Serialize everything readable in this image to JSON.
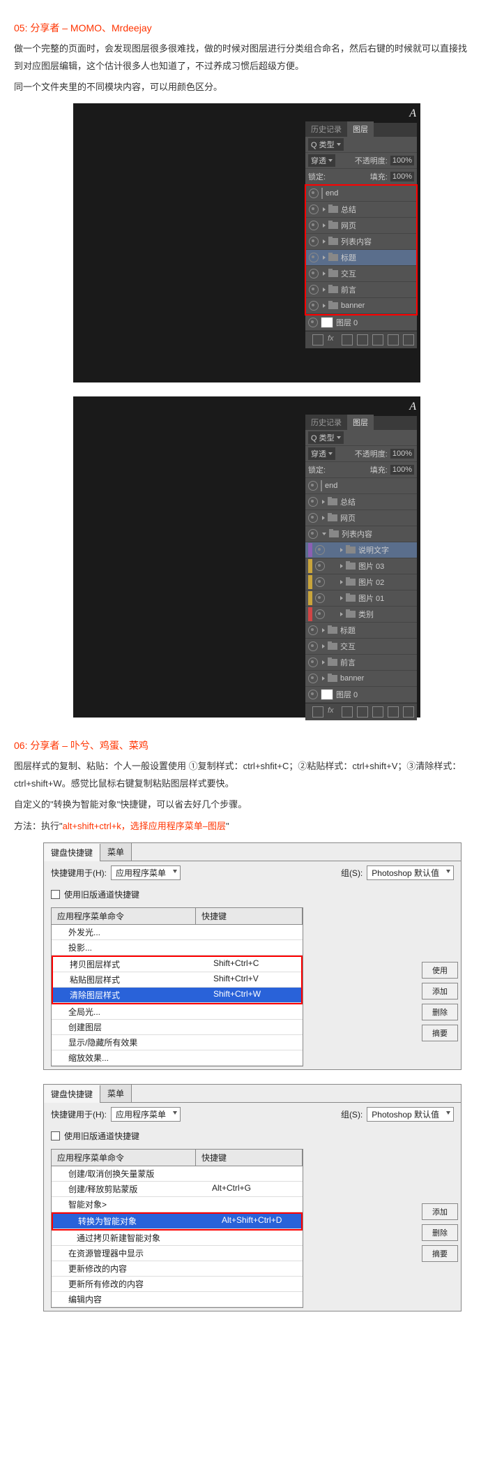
{
  "section05": {
    "title": "05: 分享者 – MOMO、Mrdeejay",
    "p1": "做一个完整的页面时，会发现图层很多很难找，做的时候对图层进行分类组合命名，然后右键的时候就可以直接找到对应图层编辑，这个估计很多人也知道了，不过养成习惯后超级方便。",
    "p2": "同一个文件夹里的不同模块内容，可以用颜色区分。"
  },
  "panelCommon": {
    "tabHistory": "历史记录",
    "tabLayers": "图层",
    "kind": "Q 类型",
    "passthrough": "穿透",
    "opacity": "不透明度:",
    "pct100": "100%",
    "lock": "锁定:",
    "fill": "填充:",
    "layerCount": "图层 0"
  },
  "ps1Layers": [
    "end",
    "总结",
    "网页",
    "列表内容",
    "标题",
    "交互",
    "前言",
    "banner"
  ],
  "ps2Layers": {
    "top": [
      "end",
      "总结",
      "网页"
    ],
    "open": "列表内容",
    "children": [
      "说明文字",
      "图片 03",
      "图片 02",
      "图片 01",
      "类别"
    ],
    "rest": [
      "标题",
      "交互",
      "前言",
      "banner"
    ]
  },
  "section06": {
    "title": "06: 分享者 – 卟兮、鸡蛋、菜鸡",
    "p1": "图层样式的复制、粘贴：个人一般设置使用 ①复制样式：ctrl+shfit+C；②粘贴样式：ctrl+shift+V；③清除样式：ctrl+shift+W。感觉比鼠标右键复制粘贴图层样式要快。",
    "p2": "自定义的\"转换为智能对象\"快捷键，可以省去好几个步骤。",
    "p3a": "方法：执行\"",
    "p3b": "alt+shift+ctrl+k，选择应用程序菜单–图层",
    "p3c": "\""
  },
  "win": {
    "tab1": "键盘快捷键",
    "tab2": "菜单",
    "labelFor": "快捷键用于(H):",
    "selectVal": "应用程序菜单",
    "setLabel": "组(S):",
    "setVal": "Photoshop 默认值",
    "useOld": "使用旧版通道快捷键",
    "col1": "应用程序菜单命令",
    "col2": "快捷键",
    "btnUse": "使用",
    "btnAdd": "添加",
    "btnDel": "删除",
    "btnSum": "摘要"
  },
  "win1Rows": [
    {
      "n": "外发光...",
      "k": ""
    },
    {
      "n": "投影...",
      "k": ""
    },
    {
      "n": "拷贝图层样式",
      "k": "Shift+Ctrl+C"
    },
    {
      "n": "粘贴图层样式",
      "k": "Shift+Ctrl+V"
    },
    {
      "n": "清除图层样式",
      "k": "Shift+Ctrl+W"
    },
    {
      "n": "全局光...",
      "k": ""
    },
    {
      "n": "创建图层",
      "k": ""
    },
    {
      "n": "显示/隐藏所有效果",
      "k": ""
    },
    {
      "n": "缩放效果...",
      "k": ""
    }
  ],
  "win2Rows": [
    {
      "n": "创建/取消创换矢量蒙版",
      "k": ""
    },
    {
      "n": "创建/释放剪贴蒙版",
      "k": "Alt+Ctrl+G"
    },
    {
      "n": "智能对象>",
      "k": ""
    },
    {
      "n": "转换为智能对象",
      "k": "Alt+Shift+Ctrl+D"
    },
    {
      "n": "通过拷贝新建智能对象",
      "k": ""
    },
    {
      "n": "在资源管理器中显示",
      "k": ""
    },
    {
      "n": "更新修改的内容",
      "k": ""
    },
    {
      "n": "更新所有修改的内容",
      "k": ""
    },
    {
      "n": "编辑内容",
      "k": ""
    }
  ]
}
